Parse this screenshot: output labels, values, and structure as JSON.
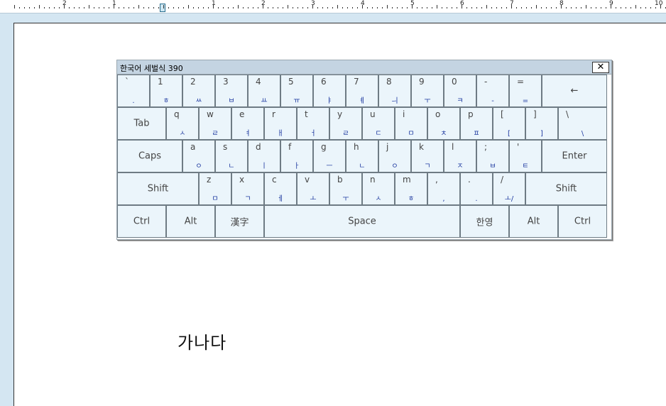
{
  "ruler": {
    "numbers": [
      "2",
      "1",
      "1",
      "2",
      "3",
      "4",
      "5",
      "6",
      "7",
      "8",
      "9",
      "10"
    ]
  },
  "keyboard": {
    "title": "한국어 세벌식 390",
    "close_label": "✕",
    "rows": [
      [
        {
          "top": "`",
          "bot": "."
        },
        {
          "top": "1",
          "bot": "ㅎ"
        },
        {
          "top": "2",
          "bot": "ㅆ"
        },
        {
          "top": "3",
          "bot": "ㅂ"
        },
        {
          "top": "4",
          "bot": "ㅛ"
        },
        {
          "top": "5",
          "bot": "ㅠ"
        },
        {
          "top": "6",
          "bot": "ㅑ"
        },
        {
          "top": "7",
          "bot": "ㅖ"
        },
        {
          "top": "8",
          "bot": "ㅢ"
        },
        {
          "top": "9",
          "bot": "ㅜ"
        },
        {
          "top": "0",
          "bot": "ㅋ"
        },
        {
          "top": "-",
          "bot": "-"
        },
        {
          "top": "=",
          "bot": "="
        },
        {
          "label": "←"
        }
      ],
      [
        {
          "label": "Tab"
        },
        {
          "top": "q",
          "bot": "ㅅ"
        },
        {
          "top": "w",
          "bot": "ㄹ"
        },
        {
          "top": "e",
          "bot": "ㅕ"
        },
        {
          "top": "r",
          "bot": "ㅐ"
        },
        {
          "top": "t",
          "bot": "ㅓ"
        },
        {
          "top": "y",
          "bot": "ㄹ"
        },
        {
          "top": "u",
          "bot": "ㄷ"
        },
        {
          "top": "i",
          "bot": "ㅁ"
        },
        {
          "top": "o",
          "bot": "ㅊ"
        },
        {
          "top": "p",
          "bot": "ㅍ"
        },
        {
          "top": "[",
          "bot": "["
        },
        {
          "top": "]",
          "bot": "]"
        },
        {
          "top": "\\",
          "bot": "\\"
        }
      ],
      [
        {
          "label": "Caps"
        },
        {
          "top": "a",
          "bot": "ㅇ"
        },
        {
          "top": "s",
          "bot": "ㄴ"
        },
        {
          "top": "d",
          "bot": "ㅣ"
        },
        {
          "top": "f",
          "bot": "ㅏ"
        },
        {
          "top": "g",
          "bot": "ㅡ"
        },
        {
          "top": "h",
          "bot": "ㄴ"
        },
        {
          "top": "j",
          "bot": "ㅇ"
        },
        {
          "top": "k",
          "bot": "ㄱ"
        },
        {
          "top": "l",
          "bot": "ㅈ"
        },
        {
          "top": ";",
          "bot": "ㅂ"
        },
        {
          "top": "'",
          "bot": "ㅌ"
        },
        {
          "label": "Enter"
        }
      ],
      [
        {
          "label": "Shift"
        },
        {
          "top": "z",
          "bot": "ㅁ"
        },
        {
          "top": "x",
          "bot": "ㄱ"
        },
        {
          "top": "c",
          "bot": "ㅔ"
        },
        {
          "top": "v",
          "bot": "ㅗ"
        },
        {
          "top": "b",
          "bot": "ㅜ"
        },
        {
          "top": "n",
          "bot": "ㅅ"
        },
        {
          "top": "m",
          "bot": "ㅎ"
        },
        {
          "top": ",",
          "bot": ","
        },
        {
          "top": ".",
          "bot": "."
        },
        {
          "top": "/",
          "bot": "ㅗ/"
        },
        {
          "label": "Shift"
        }
      ],
      [
        {
          "label": "Ctrl"
        },
        {
          "label": "Alt"
        },
        {
          "label": "漢字"
        },
        {
          "label": "Space"
        },
        {
          "label": "한영"
        },
        {
          "label": "Alt"
        },
        {
          "label": "Ctrl"
        }
      ]
    ]
  },
  "document": {
    "text": "가나다"
  }
}
